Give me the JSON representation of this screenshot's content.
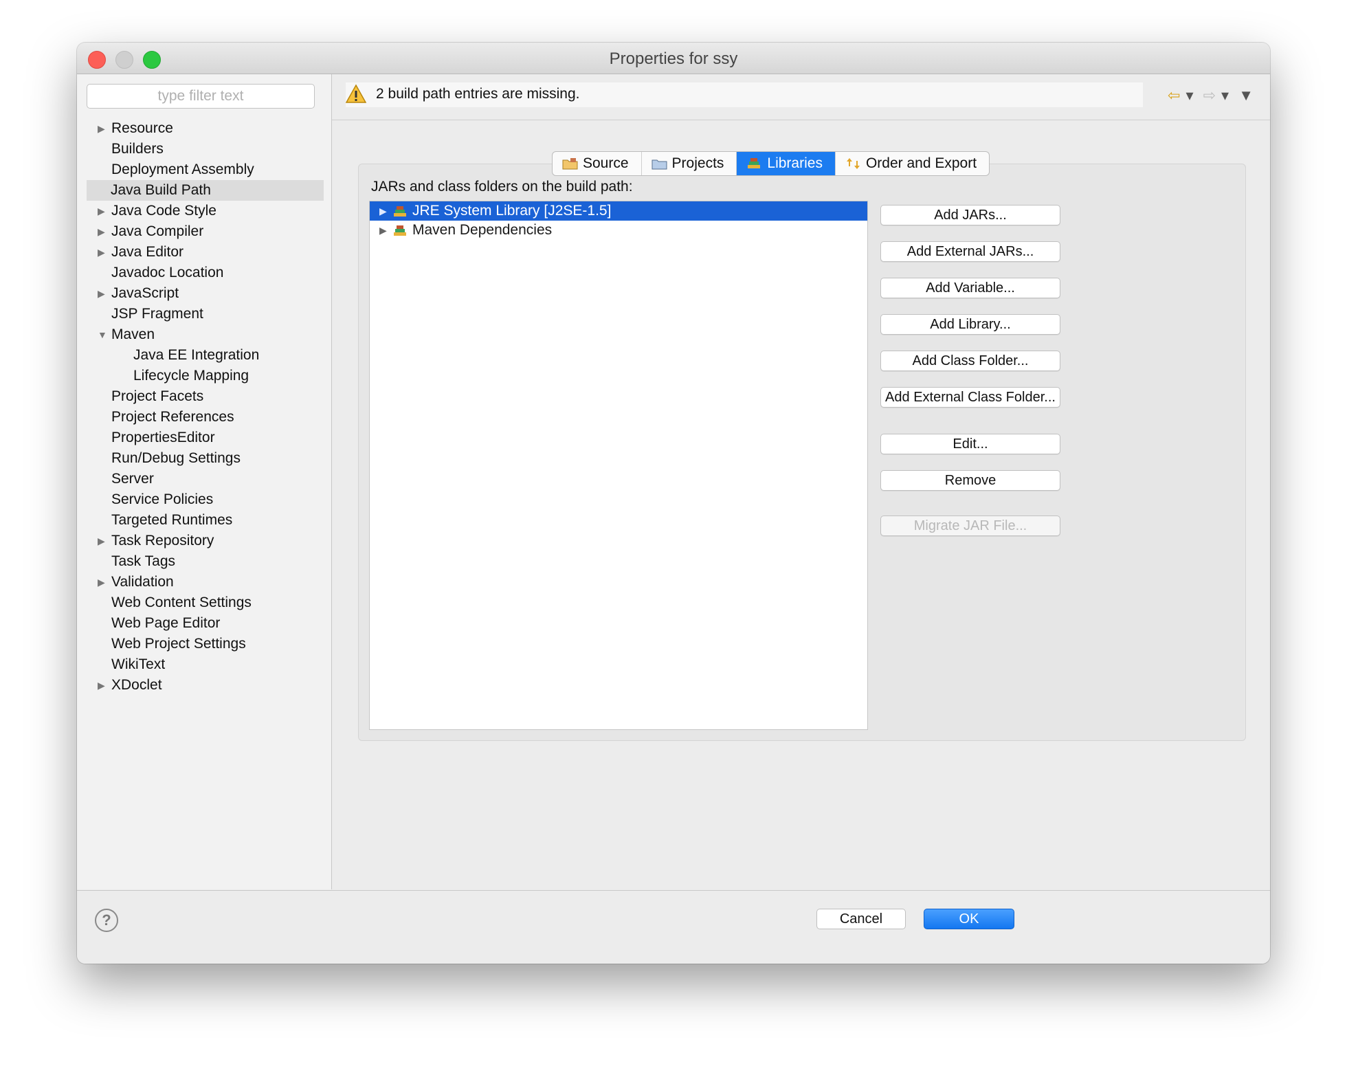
{
  "window": {
    "title": "Properties for ssy"
  },
  "filter": {
    "placeholder": "type filter text"
  },
  "sidebar": {
    "items": [
      {
        "label": "Resource",
        "arrow": "▶"
      },
      {
        "label": "Builders",
        "arrow": ""
      },
      {
        "label": "Deployment Assembly",
        "arrow": ""
      },
      {
        "label": "Java Build Path",
        "arrow": ""
      },
      {
        "label": "Java Code Style",
        "arrow": "▶"
      },
      {
        "label": "Java Compiler",
        "arrow": "▶"
      },
      {
        "label": "Java Editor",
        "arrow": "▶"
      },
      {
        "label": "Javadoc Location",
        "arrow": ""
      },
      {
        "label": "JavaScript",
        "arrow": "▶"
      },
      {
        "label": "JSP Fragment",
        "arrow": ""
      },
      {
        "label": "Maven",
        "arrow": "▼"
      },
      {
        "label": "Java EE Integration",
        "arrow": ""
      },
      {
        "label": "Lifecycle Mapping",
        "arrow": ""
      },
      {
        "label": "Project Facets",
        "arrow": ""
      },
      {
        "label": "Project References",
        "arrow": ""
      },
      {
        "label": "PropertiesEditor",
        "arrow": ""
      },
      {
        "label": "Run/Debug Settings",
        "arrow": ""
      },
      {
        "label": "Server",
        "arrow": ""
      },
      {
        "label": "Service Policies",
        "arrow": ""
      },
      {
        "label": "Targeted Runtimes",
        "arrow": ""
      },
      {
        "label": "Task Repository",
        "arrow": "▶"
      },
      {
        "label": "Task Tags",
        "arrow": ""
      },
      {
        "label": "Validation",
        "arrow": "▶"
      },
      {
        "label": "Web Content Settings",
        "arrow": ""
      },
      {
        "label": "Web Page Editor",
        "arrow": ""
      },
      {
        "label": "Web Project Settings",
        "arrow": ""
      },
      {
        "label": "WikiText",
        "arrow": ""
      },
      {
        "label": "XDoclet",
        "arrow": "▶"
      }
    ]
  },
  "message": {
    "text": "2 build path entries are missing."
  },
  "nav": {
    "back": "⇦",
    "forward": "⇨",
    "dropdown": "▾",
    "menu": "▼"
  },
  "tabs": [
    {
      "label": "Source"
    },
    {
      "label": "Projects"
    },
    {
      "label": "Libraries"
    },
    {
      "label": "Order and Export"
    }
  ],
  "libraries": {
    "heading": "JARs and class folders on the build path:",
    "entries": [
      {
        "label": "JRE System Library [J2SE-1.5]",
        "arrow": "▶"
      },
      {
        "label": "Maven Dependencies",
        "arrow": "▶"
      }
    ],
    "buttons": {
      "add_jars": "Add JARs...",
      "add_external_jars": "Add External JARs...",
      "add_variable": "Add Variable...",
      "add_library": "Add Library...",
      "add_class_folder": "Add Class Folder...",
      "add_external_class_folder": "Add External Class Folder...",
      "edit": "Edit...",
      "remove": "Remove",
      "migrate_jar": "Migrate JAR File..."
    }
  },
  "footer": {
    "help": "?",
    "cancel": "Cancel",
    "ok": "OK"
  },
  "colors": {
    "accent": "#1c7cf0",
    "selection": "#1a62d6",
    "close": "#fc5f57",
    "max": "#2bc840"
  }
}
